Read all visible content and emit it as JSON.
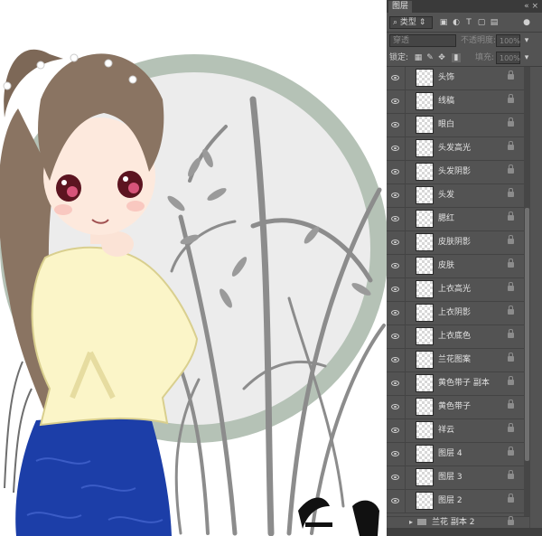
{
  "layers_panel": {
    "tab_label": "图层",
    "filter_label": "类型",
    "blend_mode": "穿透",
    "opacity_label": "不透明度:",
    "opacity_value": "100%",
    "lock_label": "锁定:",
    "fill_label": "填充:",
    "fill_value": "100%",
    "layers": [
      {
        "name": "头饰"
      },
      {
        "name": "线稿"
      },
      {
        "name": "眼白"
      },
      {
        "name": "头发高光"
      },
      {
        "name": "头发阴影"
      },
      {
        "name": "头发"
      },
      {
        "name": "腮红"
      },
      {
        "name": "皮肤阴影"
      },
      {
        "name": "皮肤"
      },
      {
        "name": "上衣高光"
      },
      {
        "name": "上衣阴影"
      },
      {
        "name": "上衣底色"
      },
      {
        "name": "兰花图案"
      },
      {
        "name": "黄色带子 副本"
      },
      {
        "name": "黄色带子"
      },
      {
        "name": "祥云"
      },
      {
        "name": "图层 4"
      },
      {
        "name": "图层 3"
      },
      {
        "name": "图层 2"
      }
    ],
    "folder_name": "兰花 副本 2"
  },
  "colors": {
    "panel_bg": "#535353",
    "circle_ring": "#b5c2b6",
    "circle_fill": "#ececec",
    "skirt": "#1c3ea8",
    "jacket": "#fbf5c8",
    "hair": "#8a7462"
  }
}
